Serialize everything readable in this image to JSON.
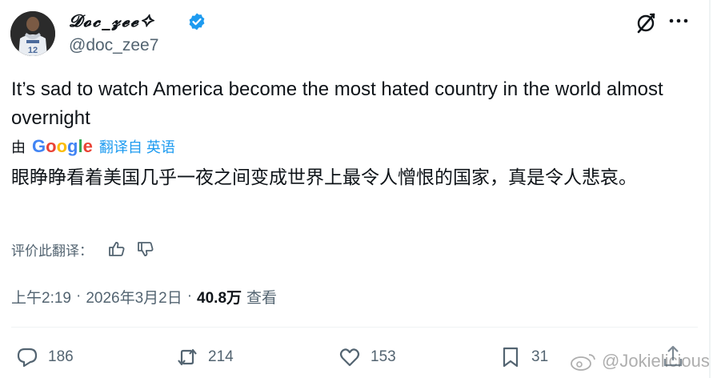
{
  "author": {
    "display_name": "𝓓𝓸𝓬_𝔃𝓮𝓮✧",
    "handle": "@doc_zee7",
    "avatar_jersey_number": "12"
  },
  "tweet": {
    "text": "It’s sad to watch America become the most hated country in the world almost overnight",
    "translation": {
      "by_label": "由",
      "provider": "Google",
      "from_label": "翻译自 英语",
      "text": "眼睁睁看着美国几乎一夜之间变成世界上最令人憎恨的国家，真是令人悲哀。"
    },
    "rate_label": "评价此翻译："
  },
  "meta": {
    "time": "上午2:19",
    "separator": "·",
    "date": "2026年3月2日",
    "views_count": "40.8万",
    "views_label": "查看"
  },
  "actions": {
    "replies": "186",
    "reposts": "214",
    "likes": "153",
    "bookmarks": "31"
  },
  "watermark": {
    "text": "@Jokielicious"
  },
  "colors": {
    "accent": "#1d9bf0",
    "text_primary": "#0f1419",
    "text_secondary": "#536471"
  }
}
